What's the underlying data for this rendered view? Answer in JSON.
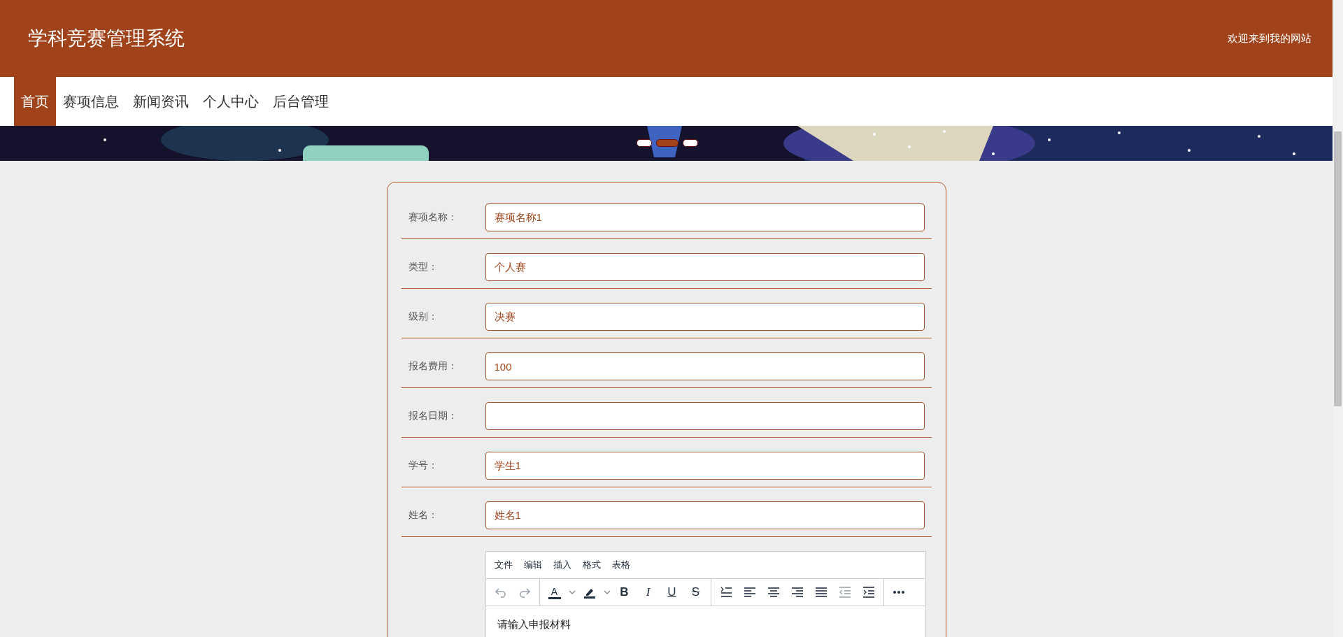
{
  "header": {
    "title": "学科竞赛管理系统",
    "welcome": "欢迎来到我的网站"
  },
  "nav": [
    {
      "label": "首页",
      "selected": true
    },
    {
      "label": "赛项信息",
      "selected": false
    },
    {
      "label": "新闻资讯",
      "selected": false
    },
    {
      "label": "个人中心",
      "selected": false
    },
    {
      "label": "后台管理",
      "selected": false
    }
  ],
  "banner": {
    "dots": [
      {
        "selected": false
      },
      {
        "selected": true
      },
      {
        "selected": false
      }
    ]
  },
  "form": {
    "fields": [
      {
        "label": "赛项名称：",
        "value": "赛项名称1"
      },
      {
        "label": "类型：",
        "value": "个人赛"
      },
      {
        "label": "级别：",
        "value": "决赛"
      },
      {
        "label": "报名费用：",
        "value": "100"
      },
      {
        "label": "报名日期："
      },
      {
        "label": "学号：",
        "value": "学生1"
      },
      {
        "label": "姓名：",
        "value": "姓名1"
      }
    ],
    "editor": {
      "menu": [
        "文件",
        "编辑",
        "插入",
        "格式",
        "表格"
      ],
      "toolbar": [
        [
          {
            "kind": "undo",
            "disabled": true
          },
          {
            "kind": "redo",
            "disabled": true
          }
        ],
        [
          {
            "kind": "text-color",
            "label": "A",
            "disabled": false
          },
          {
            "kind": "caret",
            "disabled": false
          },
          {
            "kind": "highlight",
            "disabled": false
          },
          {
            "kind": "caret",
            "disabled": false
          },
          {
            "kind": "bold",
            "label": "B",
            "disabled": false
          },
          {
            "kind": "italic",
            "label": "I",
            "disabled": false
          },
          {
            "kind": "underline",
            "label": "U",
            "disabled": false
          },
          {
            "kind": "strike",
            "label": "S",
            "disabled": false
          }
        ],
        [
          {
            "kind": "line-height",
            "disabled": false
          },
          {
            "kind": "align-left",
            "disabled": false
          },
          {
            "kind": "align-center",
            "disabled": false
          },
          {
            "kind": "align-right",
            "disabled": false
          },
          {
            "kind": "justify",
            "disabled": false
          },
          {
            "kind": "outdent",
            "disabled": true
          },
          {
            "kind": "indent",
            "disabled": false
          }
        ],
        [
          {
            "kind": "more",
            "disabled": false
          }
        ]
      ],
      "placeholder": "请输入申报材料"
    }
  }
}
